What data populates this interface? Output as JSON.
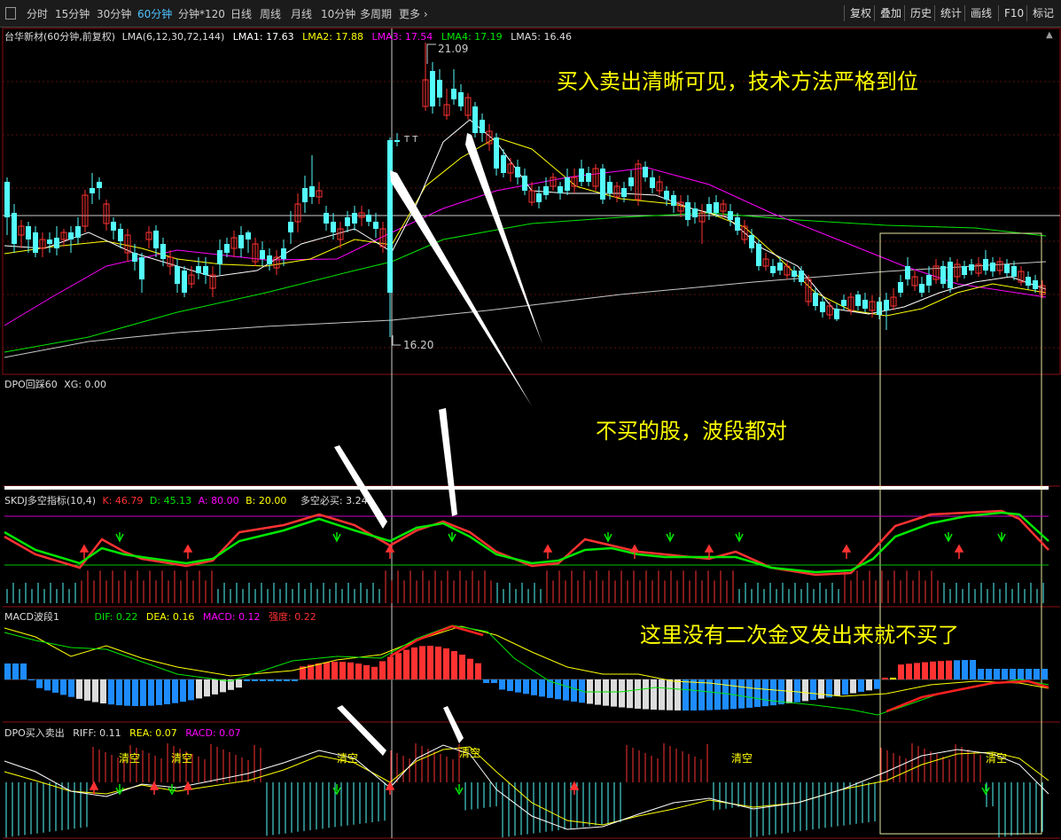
{
  "toolbar": {
    "periods": [
      "分时",
      "15分钟",
      "30分钟",
      "60分钟",
      "分钟*120",
      "日线",
      "周线",
      "月线",
      "10分钟",
      "多周期",
      "更多"
    ],
    "active_period": "60分钟",
    "right_buttons": [
      "复权",
      "叠加",
      "历史",
      "统计",
      "画线",
      "F10",
      "标记"
    ]
  },
  "main_panel": {
    "stock": "台华新材(60分钟,前复权)",
    "indicator": "LMA(6,12,30,72,144)",
    "lma1": "LMA1: 17.63",
    "lma2": "LMA2: 17.88",
    "lma3": "LMA3: 17.54",
    "lma4": "LMA4: 17.19",
    "lma5": "LMA5: 16.46",
    "high_label": "21.09",
    "low_label": "16.20",
    "tt_marker": "T T"
  },
  "dpo_panel": {
    "title": "DPO回踩60",
    "xg": "XG: 0.00"
  },
  "skdj_panel": {
    "title": "SKDJ多空指标(10,4)",
    "k": "K: 46.79",
    "d": "D: 45.13",
    "a": "A: 80.00",
    "b": "B: 20.00",
    "ls": "多空必买: 3.24"
  },
  "macd_panel": {
    "title": "MACD波段1",
    "dif": "DIF: 0.22",
    "dea": "DEA: 0.16",
    "macd": "MACD: 0.12",
    "strength": "强度: 0.22"
  },
  "dpo2_panel": {
    "title": "DPO买入卖出",
    "riff": "RIFF: 0.11",
    "rea": "REA: 0.07",
    "racd": "RACD: 0.07",
    "clear_labels": [
      "清空",
      "清空",
      "清空",
      "清空",
      "清空",
      "清空"
    ]
  },
  "annotations": {
    "a1": "买入卖出清晰可见，技术方法严格到位",
    "a2": "不买的股，波段都对",
    "a3": "这里没有二次金叉发出来就不买了"
  },
  "colors": {
    "up": "#ff3232",
    "down": "#54fcfc",
    "lma1": "#ffffff",
    "lma2": "#ffff00",
    "lma3": "#ff00ff",
    "lma4": "#00e600",
    "lma5": "#c8c8c8"
  }
}
